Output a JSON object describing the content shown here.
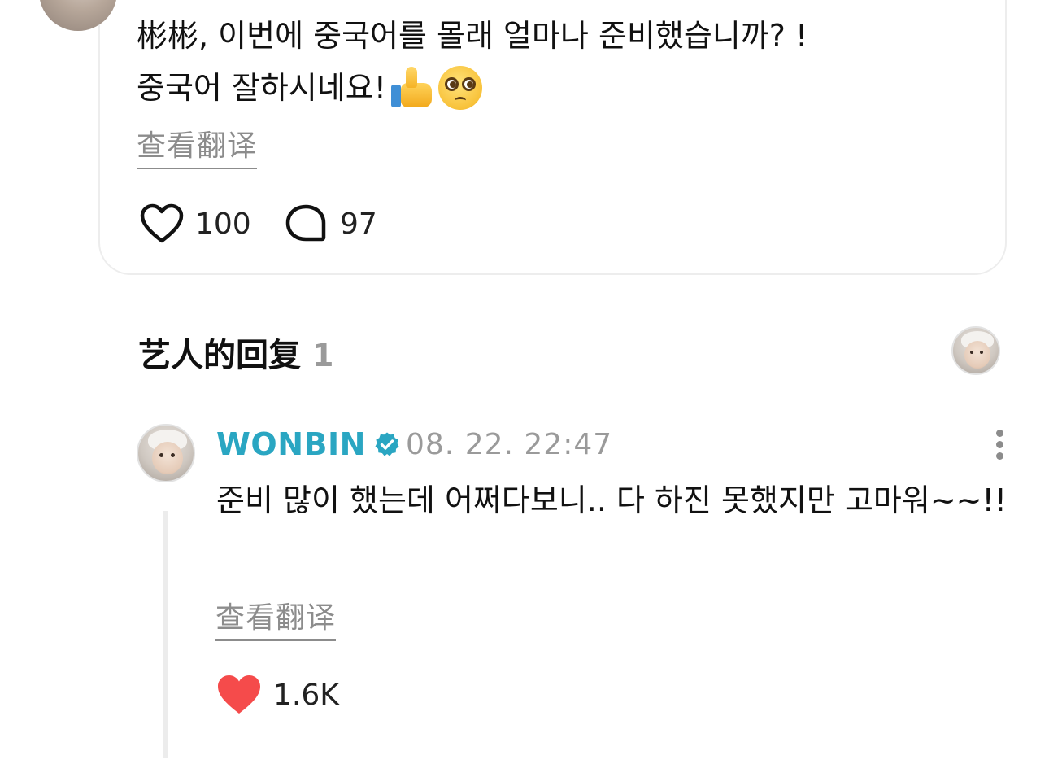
{
  "post": {
    "text_line1": "彬彬, 이번에 중국어를 몰래 얼마나 준비했습니까? !",
    "text_line2": "중국어 잘하시네요!",
    "emojis": [
      "thumbs-up-icon",
      "pleading-face-icon"
    ],
    "translate_label": "查看翻译",
    "likes": "100",
    "comments": "97"
  },
  "artist_replies": {
    "title": "艺人的回复",
    "count": "1"
  },
  "reply": {
    "author": "WONBIN",
    "verified": true,
    "timestamp": "08. 22. 22:47",
    "text": "준비 많이 했는데 어쩌다보니.. 다 하진 못했지만 고마워~~!!",
    "translate_label": "查看翻译",
    "likes": "1.6K",
    "like_color": "#f54b4b",
    "accent_color": "#2aa6c2"
  }
}
